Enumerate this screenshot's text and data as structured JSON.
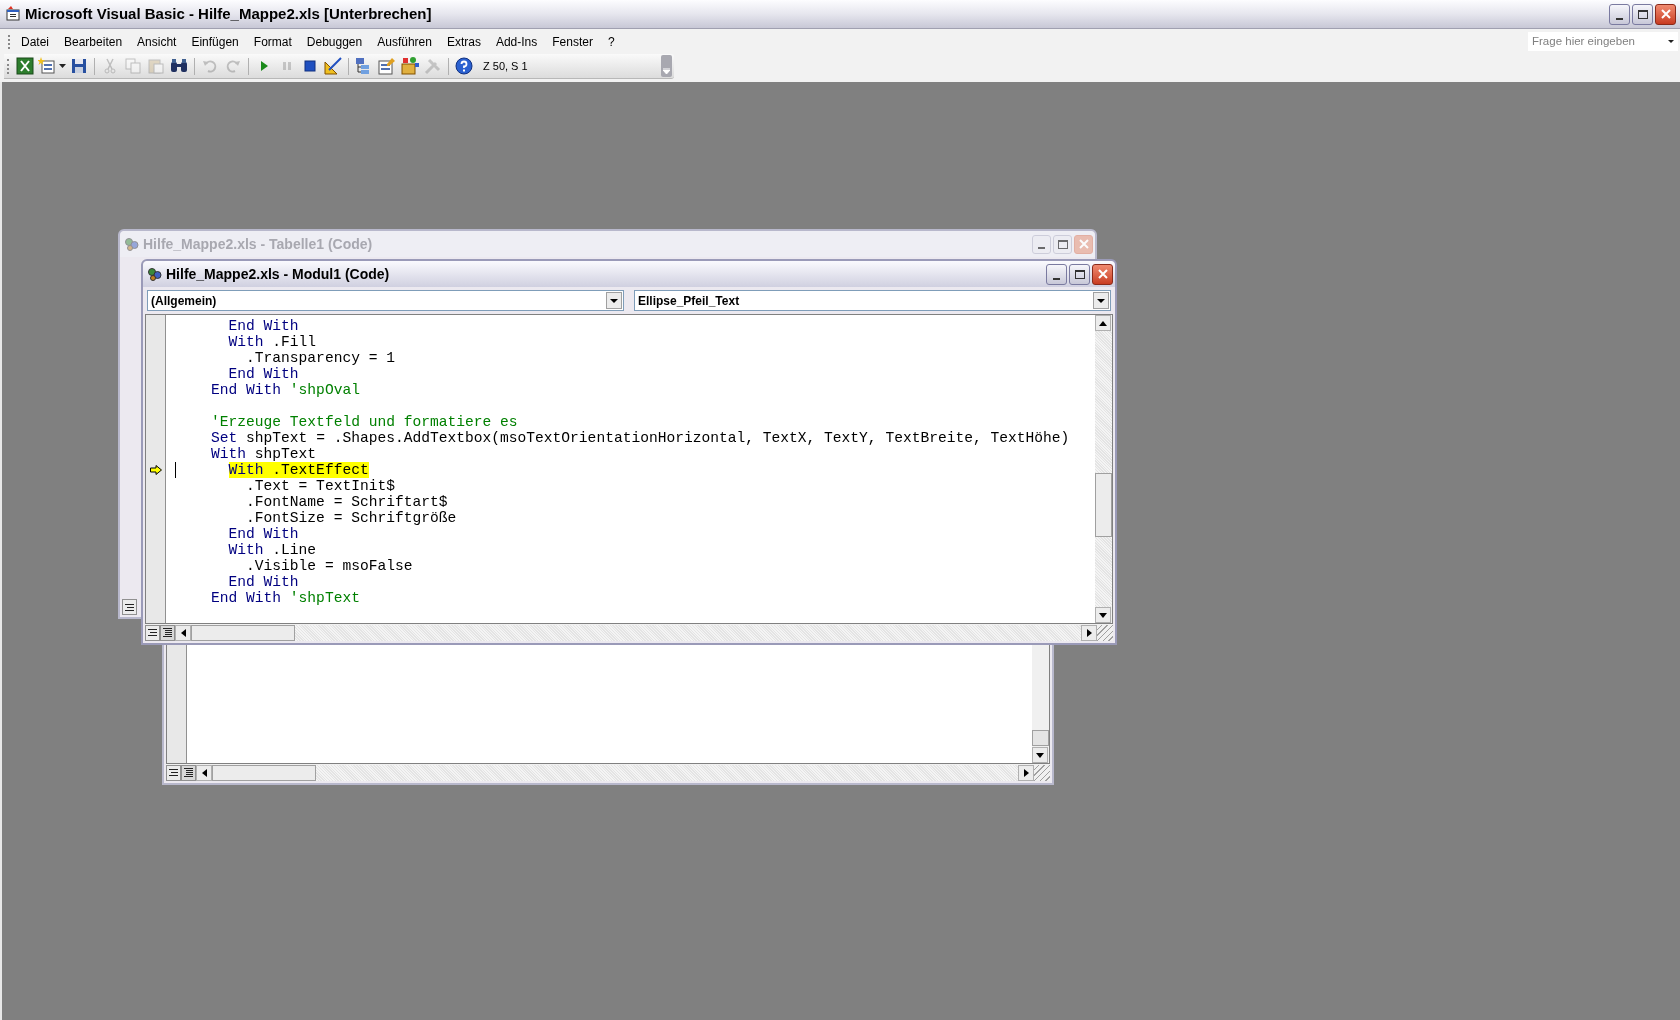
{
  "window": {
    "title": "Microsoft Visual Basic - Hilfe_Mappe2.xls [Unterbrechen]"
  },
  "menu": [
    "Datei",
    "Bearbeiten",
    "Ansicht",
    "Einfügen",
    "Format",
    "Debuggen",
    "Ausführen",
    "Extras",
    "Add-Ins",
    "Fenster",
    "?"
  ],
  "help_search": {
    "placeholder": "Frage hier eingeben"
  },
  "toolbar": [
    {
      "kind": "button",
      "disabled": false
    },
    {
      "kind": "dropdown",
      "disabled": false
    },
    {
      "kind": "button",
      "disabled": false
    },
    {
      "kind": "separator"
    },
    {
      "kind": "button",
      "disabled": true
    },
    {
      "kind": "button",
      "disabled": true
    },
    {
      "kind": "button",
      "disabled": true
    },
    {
      "kind": "button",
      "disabled": false
    },
    {
      "kind": "separator"
    },
    {
      "kind": "button",
      "disabled": true
    },
    {
      "kind": "button",
      "disabled": true
    },
    {
      "kind": "separator"
    },
    {
      "kind": "button",
      "disabled": false
    },
    {
      "kind": "button",
      "disabled": true
    },
    {
      "kind": "button",
      "disabled": false
    },
    {
      "kind": "button",
      "disabled": false
    },
    {
      "kind": "separator"
    },
    {
      "kind": "button",
      "disabled": false
    },
    {
      "kind": "button",
      "disabled": false
    },
    {
      "kind": "button",
      "disabled": false
    },
    {
      "kind": "button",
      "disabled": true
    },
    {
      "kind": "separator"
    },
    {
      "kind": "button",
      "disabled": false
    }
  ],
  "position": "Z 50, S 1",
  "back_window": {
    "title": "Hilfe_Mappe2.xls - Tabelle1 (Code)",
    "active": false
  },
  "code_window": {
    "title": "Hilfe_Mappe2.xls - Modul1 (Code)",
    "active": true,
    "object": "(Allgemein)",
    "procedure": "Ellipse_Pfeil_Text",
    "lines": [
      {
        "current": false,
        "segments": [
          {
            "kind": "keyword",
            "text": "      End With"
          }
        ]
      },
      {
        "current": false,
        "segments": [
          {
            "kind": "keyword",
            "text": "      With"
          },
          {
            "kind": "plain",
            "text": " .Fill"
          }
        ]
      },
      {
        "current": false,
        "segments": [
          {
            "kind": "plain",
            "text": "        .Transparency = 1"
          }
        ]
      },
      {
        "current": false,
        "segments": [
          {
            "kind": "keyword",
            "text": "      End With"
          }
        ]
      },
      {
        "current": false,
        "segments": [
          {
            "kind": "keyword",
            "text": "    End With"
          },
          {
            "kind": "comment",
            "text": " 'shpOval"
          }
        ]
      },
      {
        "current": false
      },
      {
        "current": false,
        "segments": [
          {
            "kind": "comment",
            "text": "    'Erzeuge Textfeld und formatiere es"
          }
        ]
      },
      {
        "current": false,
        "segments": [
          {
            "kind": "keyword",
            "text": "    Set"
          },
          {
            "kind": "plain",
            "text": " shpText = .Shapes.AddTextbox(msoTextOrientationHorizontal, TextX, TextY, TextBreite, TextHöhe)"
          }
        ]
      },
      {
        "current": false,
        "segments": [
          {
            "kind": "keyword",
            "text": "    With"
          },
          {
            "kind": "plain",
            "text": " shpText"
          }
        ]
      },
      {
        "current": true,
        "segments": [
          {
            "kind": "keyword",
            "text": "      With"
          },
          {
            "kind": "plain",
            "text": " .TextEffect"
          }
        ]
      },
      {
        "current": false,
        "segments": [
          {
            "kind": "plain",
            "text": "        .Text = TextInit$"
          }
        ]
      },
      {
        "current": false,
        "segments": [
          {
            "kind": "plain",
            "text": "        .FontName = Schriftart$"
          }
        ]
      },
      {
        "current": false,
        "segments": [
          {
            "kind": "plain",
            "text": "        .FontSize = Schriftgröße"
          }
        ]
      },
      {
        "current": false,
        "segments": [
          {
            "kind": "keyword",
            "text": "      End With"
          }
        ]
      },
      {
        "current": false,
        "segments": [
          {
            "kind": "keyword",
            "text": "      With"
          },
          {
            "kind": "plain",
            "text": " .Line"
          }
        ]
      },
      {
        "current": false,
        "segments": [
          {
            "kind": "plain",
            "text": "        .Visible = msoFalse"
          }
        ]
      },
      {
        "current": false,
        "segments": [
          {
            "kind": "keyword",
            "text": "      End With"
          }
        ]
      },
      {
        "current": false,
        "segments": [
          {
            "kind": "keyword",
            "text": "    End With"
          },
          {
            "kind": "comment",
            "text": " 'shpText"
          }
        ]
      }
    ]
  }
}
